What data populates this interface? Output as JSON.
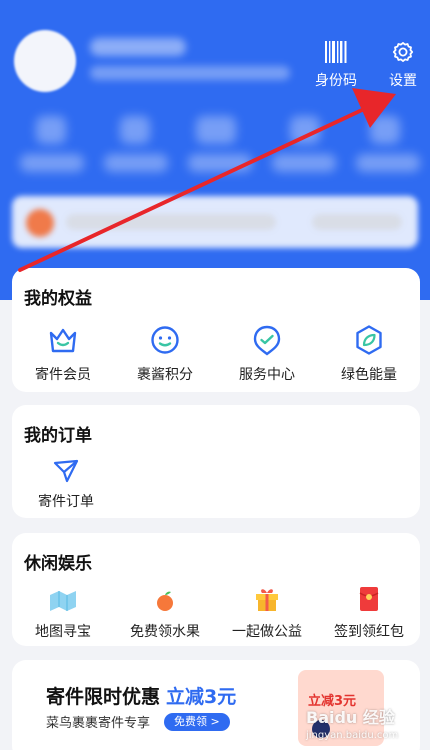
{
  "header": {
    "id_code": {
      "label": "身份码",
      "icon": "barcode-icon"
    },
    "settings": {
      "label": "设置",
      "icon": "gear-icon"
    }
  },
  "benefits": {
    "title": "我的权益",
    "items": [
      {
        "label": "寄件会员",
        "icon": "crown-icon"
      },
      {
        "label": "裹酱积分",
        "icon": "smiley-icon"
      },
      {
        "label": "服务中心",
        "icon": "service-badge-icon"
      },
      {
        "label": "绿色能量",
        "icon": "leaf-icon"
      }
    ]
  },
  "orders": {
    "title": "我的订单",
    "items": [
      {
        "label": "寄件订单",
        "icon": "paper-plane-icon"
      }
    ]
  },
  "leisure": {
    "title": "休闲娱乐",
    "items": [
      {
        "label": "地图寻宝",
        "icon": "map-icon"
      },
      {
        "label": "免费领水果",
        "icon": "fruit-icon"
      },
      {
        "label": "一起做公益",
        "icon": "gift-box-icon"
      },
      {
        "label": "签到领红包",
        "icon": "red-envelope-icon"
      }
    ]
  },
  "promo": {
    "title": "寄件限时优惠",
    "highlight": "立减3元",
    "subtitle": "菜鸟裹裹寄件专享",
    "button": "免费领 >",
    "coupon_text": "立减3元"
  },
  "watermark": {
    "text": "Baidu 经验",
    "sub": "jingyan.baidu.com"
  },
  "colors": {
    "brand_blue": "#2f6bf1",
    "arrow_red": "#e8262a",
    "background": "#f2f3f7"
  }
}
